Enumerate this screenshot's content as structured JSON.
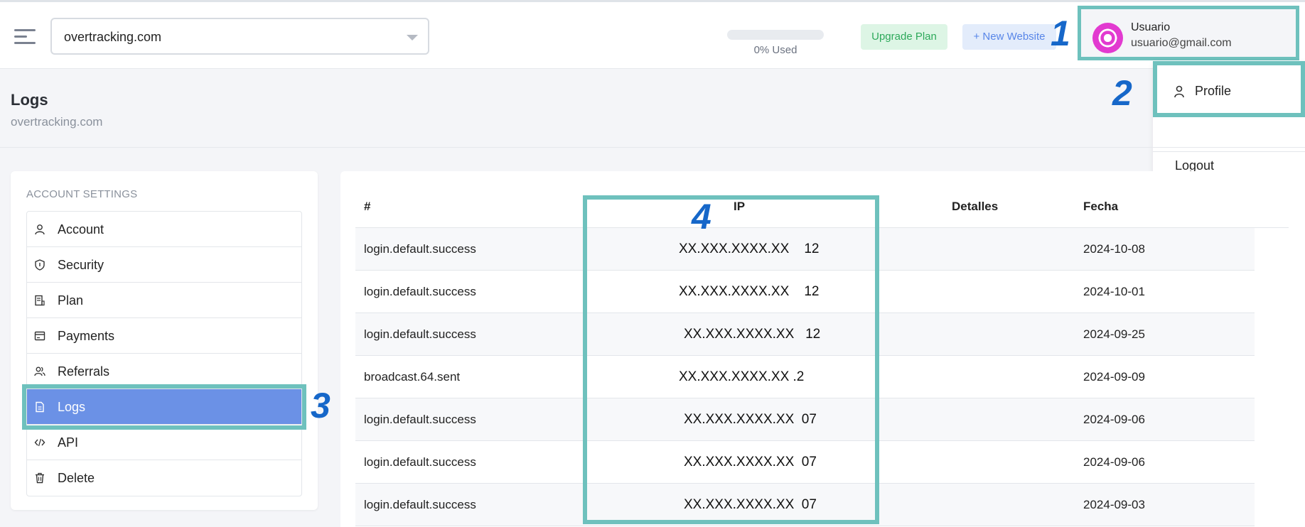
{
  "header": {
    "site_value": "overtracking.com",
    "usage_label": "0% Used",
    "usage_fraction": 0,
    "upgrade_label": "Upgrade Plan",
    "new_website_label": "+ New Website",
    "user": {
      "name": "Usuario",
      "email": "usuario@gmail.com"
    }
  },
  "dropdown": {
    "profile_label": "Profile",
    "logout_label": "Logout"
  },
  "page": {
    "title": "Logs",
    "subtitle": "overtracking.com"
  },
  "sidebar": {
    "section_label": "ACCOUNT SETTINGS",
    "items": [
      {
        "label": "Account",
        "icon": "user-icon"
      },
      {
        "label": "Security",
        "icon": "shield-icon"
      },
      {
        "label": "Plan",
        "icon": "plan-icon"
      },
      {
        "label": "Payments",
        "icon": "credit-card-icon"
      },
      {
        "label": "Referrals",
        "icon": "users-icon"
      },
      {
        "label": "Logs",
        "icon": "document-icon",
        "active": true
      },
      {
        "label": "API",
        "icon": "code-icon"
      },
      {
        "label": "Delete",
        "icon": "trash-icon"
      }
    ]
  },
  "table": {
    "headers": {
      "event": "#",
      "ip": "IP",
      "details": "Detalles",
      "date": "Fecha"
    },
    "rows": [
      {
        "event": "login.default.success",
        "ip": "XX.XXX.XXXX.XX    12",
        "date": "2024-10-08"
      },
      {
        "event": "login.default.success",
        "ip": "XX.XXX.XXXX.XX    12",
        "date": "2024-10-01"
      },
      {
        "event": "login.default.success",
        "ip": "XX.XXX.XXXX.XX   12",
        "date": "2024-09-25"
      },
      {
        "event": "broadcast.64.sent",
        "ip": "XX.XXX.XXXX.XX .2",
        "date": "2024-09-09"
      },
      {
        "event": "login.default.success",
        "ip": "XX.XXX.XXXX.XX  07",
        "date": "2024-09-06"
      },
      {
        "event": "login.default.success",
        "ip": "XX.XXX.XXXX.XX  07",
        "date": "2024-09-06"
      },
      {
        "event": "login.default.success",
        "ip": "XX.XXX.XXXX.XX  07",
        "date": "2024-09-03"
      }
    ]
  },
  "markers": [
    "1",
    "2",
    "3",
    "4"
  ],
  "colors": {
    "highlight": "#6ec1bd",
    "marker": "#1667c9",
    "active_item": "#6b91e6",
    "upgrade": "#2ea95b",
    "new_website": "#5886e8"
  }
}
